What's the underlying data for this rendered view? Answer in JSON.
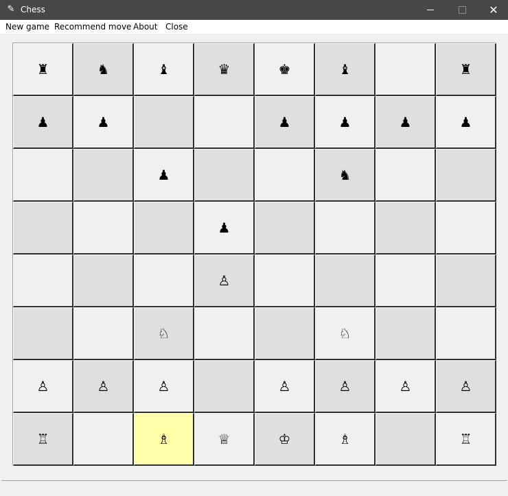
{
  "window": {
    "title": "Chess",
    "icon": "feather-icon",
    "controls": {
      "minimize": "minimize-icon",
      "maximize": "maximize-icon",
      "close": "close-icon"
    }
  },
  "menu": {
    "items": [
      "New game",
      "Recommend move",
      "About",
      "Close"
    ]
  },
  "board": {
    "selected_square": "c1",
    "selected_color": "#ffffaa",
    "light_color": "#f0f0f0",
    "dark_color": "#dfdfdf",
    "rows": [
      [
        "♜",
        "♞",
        "♝",
        "♛",
        "♚",
        "♝",
        "",
        "♜"
      ],
      [
        "♟",
        "♟",
        "",
        "",
        "♟",
        "♟",
        "♟",
        "♟"
      ],
      [
        "",
        "",
        "♟",
        "",
        "",
        "♞",
        "",
        ""
      ],
      [
        "",
        "",
        "",
        "♟",
        "",
        "",
        "",
        ""
      ],
      [
        "",
        "",
        "",
        "♙",
        "",
        "",
        "",
        ""
      ],
      [
        "",
        "",
        "♘",
        "",
        "",
        "♘",
        "",
        ""
      ],
      [
        "♙",
        "♙",
        "♙",
        "",
        "♙",
        "♙",
        "♙",
        "♙"
      ],
      [
        "♖",
        "",
        "♗",
        "♕",
        "♔",
        "♗",
        "",
        "♖"
      ]
    ]
  },
  "status": {
    "text": ""
  }
}
